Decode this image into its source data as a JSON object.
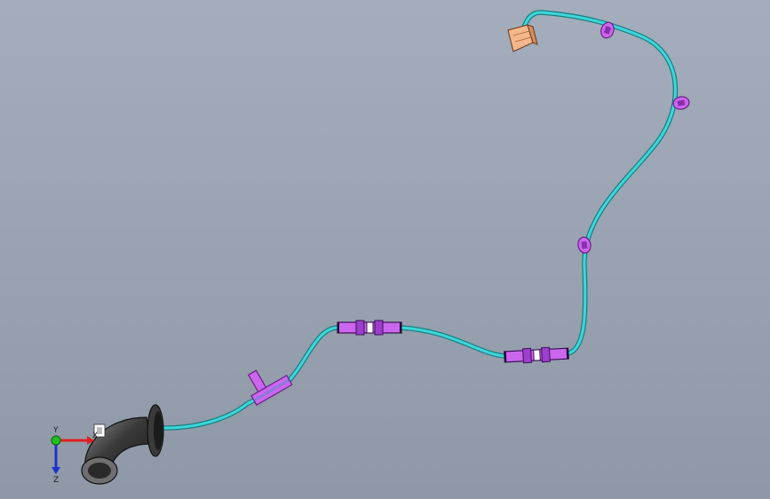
{
  "viewport": {
    "background_top": "#a3adbb",
    "background_bottom": "#8f98a6"
  },
  "model": {
    "cable_color": "#3ed6d8",
    "cable_outline": "#1a7f86",
    "connector_color": "#cc66ee",
    "connector_outline": "#6a1f86",
    "terminal_block_color": "#f4b68a",
    "grommet_color": "#3a3a3a"
  },
  "triad": {
    "x_label": "X",
    "y_label": "Y",
    "z_label": "Z",
    "x_color": "#e02020",
    "y_color": "#20c020",
    "z_color": "#2030d0"
  }
}
